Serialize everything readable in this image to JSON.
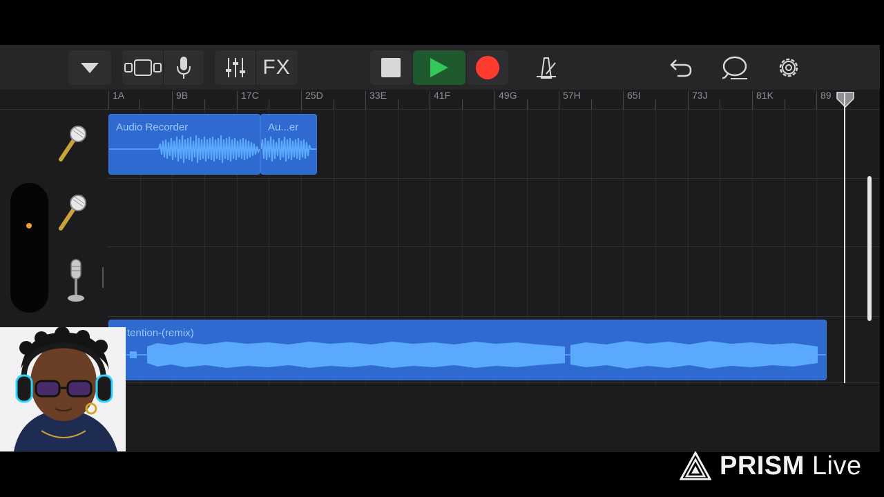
{
  "toolbar": {
    "fx_label": "FX",
    "buttons": [
      "tracks-view-dropdown",
      "browser-view",
      "instrument-mic",
      "mixer",
      "fx",
      "stop",
      "play",
      "record",
      "metronome",
      "undo",
      "loop-browser",
      "settings"
    ]
  },
  "ruler": {
    "markers": [
      "1A",
      "9B",
      "17C",
      "25D",
      "33E",
      "41F",
      "49G",
      "57H",
      "65I",
      "73J",
      "81K",
      "89"
    ]
  },
  "tracks": [
    {
      "name": "track-1",
      "icon": "microphone-icon",
      "regions": [
        {
          "label": "Audio Recorder"
        },
        {
          "label": "Au...er"
        }
      ]
    },
    {
      "name": "track-2",
      "icon": "microphone-icon",
      "regions": []
    },
    {
      "name": "track-3",
      "icon": "studio-microphone-icon",
      "regions": []
    },
    {
      "name": "track-4",
      "icon": "none",
      "regions": [
        {
          "label": "tention-(remix)"
        }
      ]
    }
  ],
  "colors": {
    "region": "#2f6ad0",
    "waveform": "#5aa9ff",
    "play": "#34c759",
    "record": "#ff3b30"
  },
  "watermark": {
    "brand": "PRISM",
    "suffix": "Live"
  }
}
